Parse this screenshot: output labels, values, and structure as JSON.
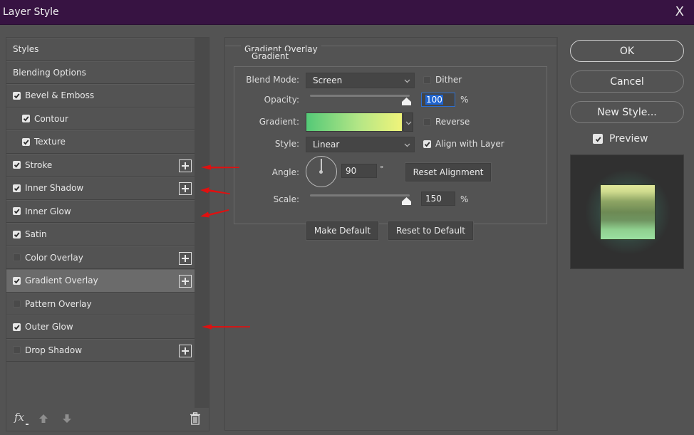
{
  "window": {
    "title": "Layer Style",
    "close_label": "X"
  },
  "styles_list": {
    "items": [
      {
        "label": "Styles",
        "has_checkbox": false,
        "checked": false,
        "has_plus": false,
        "selected": false,
        "indent": false
      },
      {
        "label": "Blending Options",
        "has_checkbox": false,
        "checked": false,
        "has_plus": false,
        "selected": false,
        "indent": false
      },
      {
        "label": "Bevel & Emboss",
        "has_checkbox": true,
        "checked": true,
        "has_plus": false,
        "selected": false,
        "indent": false
      },
      {
        "label": "Contour",
        "has_checkbox": true,
        "checked": true,
        "has_plus": false,
        "selected": false,
        "indent": true
      },
      {
        "label": "Texture",
        "has_checkbox": true,
        "checked": true,
        "has_plus": false,
        "selected": false,
        "indent": true
      },
      {
        "label": "Stroke",
        "has_checkbox": true,
        "checked": true,
        "has_plus": true,
        "selected": false,
        "indent": false
      },
      {
        "label": "Inner Shadow",
        "has_checkbox": true,
        "checked": true,
        "has_plus": true,
        "selected": false,
        "indent": false
      },
      {
        "label": "Inner Glow",
        "has_checkbox": true,
        "checked": true,
        "has_plus": false,
        "selected": false,
        "indent": false
      },
      {
        "label": "Satin",
        "has_checkbox": true,
        "checked": true,
        "has_plus": false,
        "selected": false,
        "indent": false
      },
      {
        "label": "Color Overlay",
        "has_checkbox": true,
        "checked": false,
        "has_plus": true,
        "selected": false,
        "indent": false
      },
      {
        "label": "Gradient Overlay",
        "has_checkbox": true,
        "checked": true,
        "has_plus": true,
        "selected": true,
        "indent": false
      },
      {
        "label": "Pattern Overlay",
        "has_checkbox": true,
        "checked": false,
        "has_plus": false,
        "selected": false,
        "indent": false
      },
      {
        "label": "Outer Glow",
        "has_checkbox": true,
        "checked": true,
        "has_plus": false,
        "selected": false,
        "indent": false
      },
      {
        "label": "Drop Shadow",
        "has_checkbox": true,
        "checked": false,
        "has_plus": true,
        "selected": false,
        "indent": false
      }
    ],
    "footer_icons": [
      "fx-icon",
      "move-up-icon",
      "move-down-icon",
      "trash-icon"
    ],
    "fx_label": "fx"
  },
  "gradient_overlay": {
    "section_title": "Gradient Overlay",
    "group_title": "Gradient",
    "blend_mode": {
      "label": "Blend Mode:",
      "value": "Screen"
    },
    "dither": {
      "label": "Dither",
      "checked": false
    },
    "opacity": {
      "label": "Opacity:",
      "value": "100",
      "unit": "%",
      "slider_fraction": 1.0
    },
    "gradient": {
      "label": "Gradient:",
      "colors": [
        "#54c977",
        "#b4e686",
        "#f0f47a"
      ]
    },
    "reverse": {
      "label": "Reverse",
      "checked": false
    },
    "style": {
      "label": "Style:",
      "value": "Linear"
    },
    "align_with_layer": {
      "label": "Align with Layer",
      "checked": true
    },
    "angle": {
      "label": "Angle:",
      "value": "90",
      "unit": "°"
    },
    "reset_alignment_label": "Reset Alignment",
    "scale": {
      "label": "Scale:",
      "value": "150",
      "unit": "%",
      "slider_fraction": 1.0
    },
    "make_default_label": "Make Default",
    "reset_default_label": "Reset to Default"
  },
  "actions": {
    "ok_label": "OK",
    "cancel_label": "Cancel",
    "new_style_label": "New Style...",
    "preview": {
      "label": "Preview",
      "checked": true
    }
  },
  "annotations": {
    "arrow_color": "#e01010",
    "arrows_point_to": [
      "Stroke",
      "Inner Shadow",
      "Inner Glow",
      "Outer Glow"
    ]
  },
  "colors": {
    "titlebar": "#371342",
    "panel_bg": "#535353",
    "selected_row": "#6b6b6b",
    "focus_blue": "#1e64d0"
  }
}
